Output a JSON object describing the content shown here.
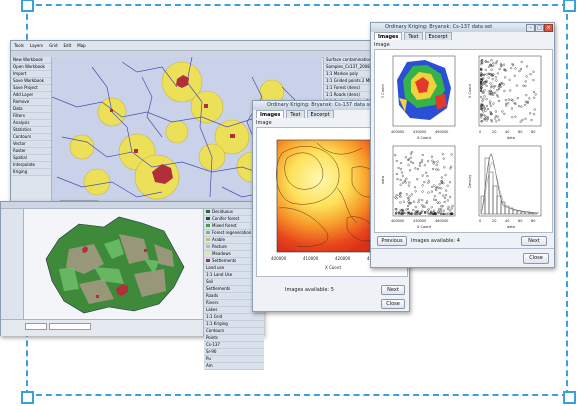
{
  "apps": {
    "gis_top": {
      "toolbar_items": [
        "Tools",
        "Layers",
        "Grid",
        "Edit",
        "Map"
      ],
      "sidebar_items": [
        "New Workbook",
        "Open Workbook",
        "Import",
        "Save Workbook",
        "Save Project",
        "Add Layer",
        "Remove",
        "Data",
        "Filters",
        "Analysis",
        "Statistics",
        "Contours",
        "Vector",
        "Raster",
        "Spatial",
        "Interpolate",
        "Kriging"
      ],
      "layer_items": [
        "Surface contamination Cs-137",
        "Samples_Cs137_2008.shp",
        "1:1 Markov poly",
        "1:1 Grided points 2 MI",
        "1:1 Forest (dens)",
        "1:1 Roads (dens)",
        "1:1 Surface Kriging OK",
        "1:1 Surface Kriging"
      ]
    },
    "gis_bottom": {
      "legend_items": [
        "Deciduous",
        "Conifer forest",
        "Mixed forest",
        "Forest regeneration",
        "Arable",
        "Pasture",
        "Meadows",
        "Settlements"
      ],
      "layer_items": [
        "Land use",
        "1:1 Land Use",
        "Soil",
        "Settlements",
        "Roads",
        "Rivers",
        "Lakes",
        "1:1 Grid",
        "1:1 Kriging",
        "Contours",
        "Points",
        "Cs-137",
        "Sr-90",
        "Pu",
        "Am"
      ]
    },
    "kriging_mid": {
      "title": "Ordinary Kriging: Bryansk: Cs-137 data set",
      "tabs": [
        "Images",
        "Text",
        "Excerpt"
      ],
      "section_label": "Image",
      "x_ticks": [
        "400000",
        "410000",
        "420000",
        "430000"
      ],
      "x_label": "X Coord",
      "images_available": "Images available: 5",
      "next_label": "Next",
      "close_label": "Close"
    },
    "kriging_front": {
      "title": "Ordinary Kriging: Bryansk: Cs-137 data set",
      "tabs": [
        "Images",
        "Text",
        "Excerpt"
      ],
      "section_label": "Image",
      "panel_tl": {
        "xlabel": "X Coord",
        "ylabel": "Y Coord",
        "x_ticks": [
          "400000",
          "430000",
          "460000"
        ]
      },
      "panel_tr": {
        "xlabel": "data",
        "ylabel": "X Coord",
        "x_ticks": [
          "0",
          "20",
          "40",
          "60",
          "80"
        ]
      },
      "panel_bl": {
        "xlabel": "X Coord",
        "ylabel": "data",
        "x_ticks": [
          "400000",
          "430000",
          "460000"
        ]
      },
      "panel_br": {
        "xlabel": "data",
        "ylabel": "Density",
        "x_ticks": [
          "0",
          "20",
          "40",
          "60",
          "80"
        ]
      },
      "previous_label": "Previous",
      "images_available": "Images available: 4",
      "next_label": "Next",
      "close_label": "Close"
    }
  },
  "colors": {
    "accent": "#3aa0dc",
    "map_bg": "#c9d2e8",
    "buffer": "#f2e24a",
    "settlement": "#b0303a",
    "land_green": "#3e8a3a"
  }
}
